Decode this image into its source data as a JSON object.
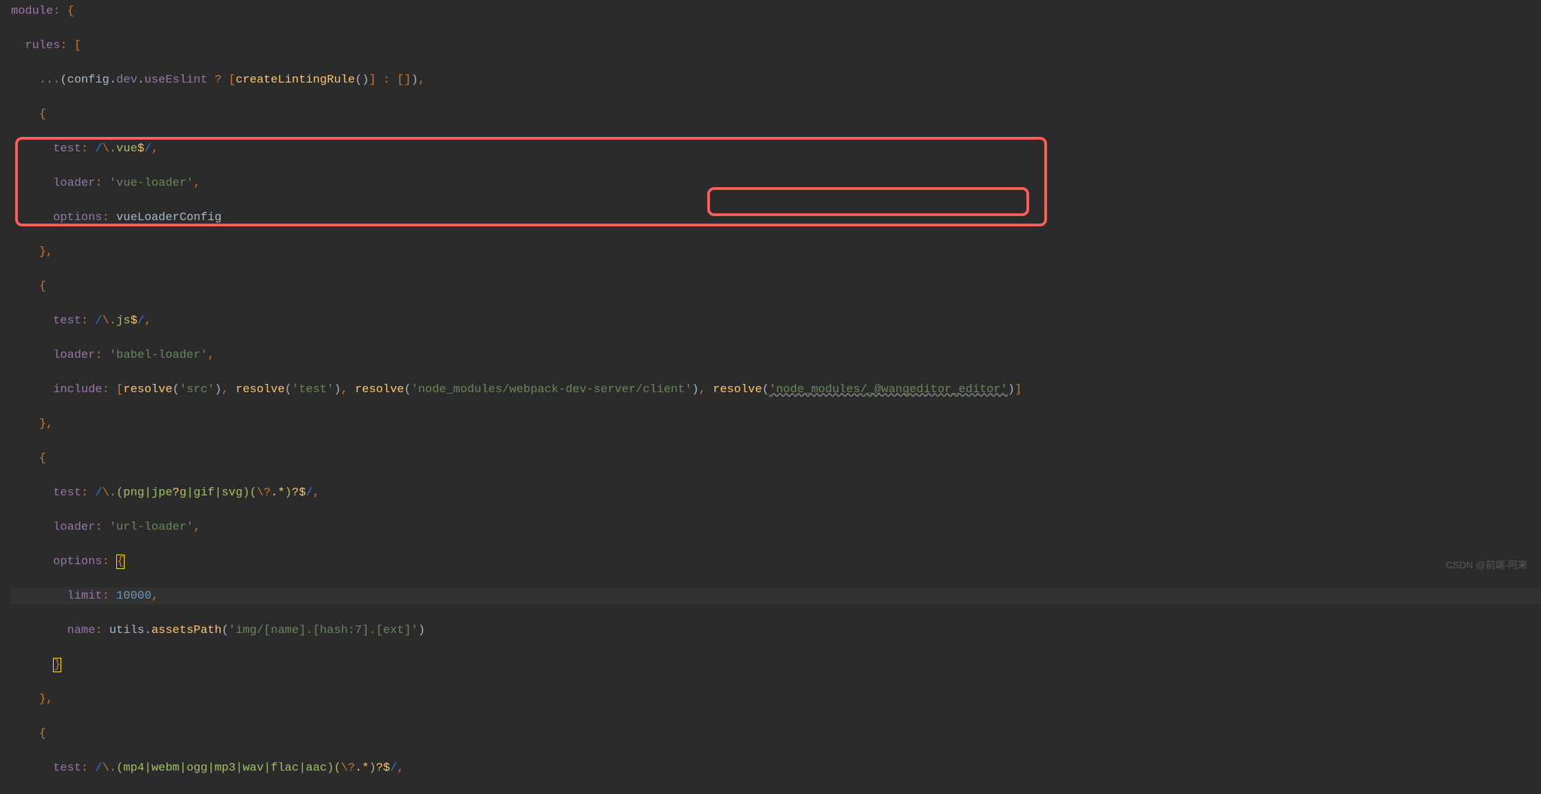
{
  "code": {
    "l1": {
      "module": "module",
      "colon": ":",
      "brace": "{"
    },
    "l2": {
      "rules": "rules",
      "colon": ":",
      "bracket": "["
    },
    "l3": {
      "spread": "...",
      "p1": "(",
      "config": "config",
      "dot1": ".",
      "dev": "dev",
      "dot2": ".",
      "use": "useEslint",
      "q": " ? ",
      "b1": "[",
      "fn": "createLintingRule",
      "p2": "(",
      "p3": ")",
      "b2": "]",
      "colon2": " : ",
      "b3": "[",
      "b4": "]",
      "p4": ")",
      "comma": ","
    },
    "l4": {
      "brace": "{"
    },
    "l5": {
      "test": "test",
      "colon": ":",
      "reg_open": "/",
      "reg_esc": "\\.",
      "reg_body": "vue",
      "reg_end": "$",
      "reg_close": "/",
      "comma": ","
    },
    "l6": {
      "loader": "loader",
      "colon": ":",
      "str": "'vue-loader'",
      "comma": ","
    },
    "l7": {
      "options": "options",
      "colon": ":",
      "val": "vueLoaderConfig"
    },
    "l8": {
      "close": "}",
      "comma": ","
    },
    "l9": {
      "brace": "{"
    },
    "l10": {
      "test": "test",
      "colon": ":",
      "reg_open": "/",
      "reg_esc": "\\.",
      "reg_body": "js",
      "reg_end": "$",
      "reg_close": "/",
      "comma": ","
    },
    "l11": {
      "loader": "loader",
      "colon": ":",
      "str": "'babel-loader'",
      "comma": ","
    },
    "l12": {
      "include": "include",
      "colon": ":",
      "b1": "[",
      "r1": "resolve",
      "p1o": "(",
      "s1": "'src'",
      "p1c": ")",
      "c1": ",",
      "r2": "resolve",
      "p2o": "(",
      "s2": "'test'",
      "p2c": ")",
      "c2": ",",
      "r3": "resolve",
      "p3o": "(",
      "s3": "'node_modules/webpack-dev-server/client'",
      "p3c": ")",
      "c3": ",",
      "r4": "resolve",
      "p4o": "(",
      "s4": "'node_modules/_@wangeditor_editor'",
      "p4c": ")",
      "b2": "]"
    },
    "l13": {
      "close": "}",
      "comma": ","
    },
    "l14": {
      "brace": "{"
    },
    "l15": {
      "test": "test",
      "colon": ":",
      "reg_open": "/",
      "reg_esc1": "\\.",
      "p1": "(",
      "png": "png",
      "pipe1": "|",
      "jpe": "jpe",
      "q": "?",
      "g": "g",
      "pipe2": "|",
      "gif": "gif",
      "pipe3": "|",
      "svg": "svg",
      "p2": ")",
      "p3": "(",
      "esc2": "\\?",
      "dot": ".",
      "star": "*",
      "p4": ")",
      "q2": "?",
      "end": "$",
      "reg_close": "/",
      "comma": ","
    },
    "l16": {
      "loader": "loader",
      "colon": ":",
      "str": "'url-loader'",
      "comma": ","
    },
    "l17": {
      "options": "options",
      "colon": ":",
      "brace": "{"
    },
    "l18": {
      "limit": "limit",
      "colon": ":",
      "num": "10000",
      "comma": ","
    },
    "l19": {
      "name": "name",
      "colon": ":",
      "utils": "utils",
      "dot": ".",
      "fn": "assetsPath",
      "p1": "(",
      "str": "'img/[name].[hash:7].[ext]'",
      "p2": ")"
    },
    "l20": {
      "close": "}"
    },
    "l21": {
      "close": "}",
      "comma": ","
    },
    "l22": {
      "brace": "{"
    },
    "l23": {
      "test": "test",
      "colon": ":",
      "reg_open": "/",
      "reg_esc1": "\\.",
      "p1": "(",
      "mp4": "mp4",
      "pipe1": "|",
      "webm": "webm",
      "pipe2": "|",
      "ogg": "ogg",
      "pipe3": "|",
      "mp3": "mp3",
      "pipe4": "|",
      "wav": "wav",
      "pipe5": "|",
      "flac": "flac",
      "pipe6": "|",
      "aac": "aac",
      "p2": ")",
      "p3": "(",
      "esc2": "\\?",
      "dot": ".",
      "star": "*",
      "p4": ")",
      "q2": "?",
      "end": "$",
      "reg_close": "/",
      "comma": ","
    }
  },
  "watermark": "CSDN @前端-阿来"
}
